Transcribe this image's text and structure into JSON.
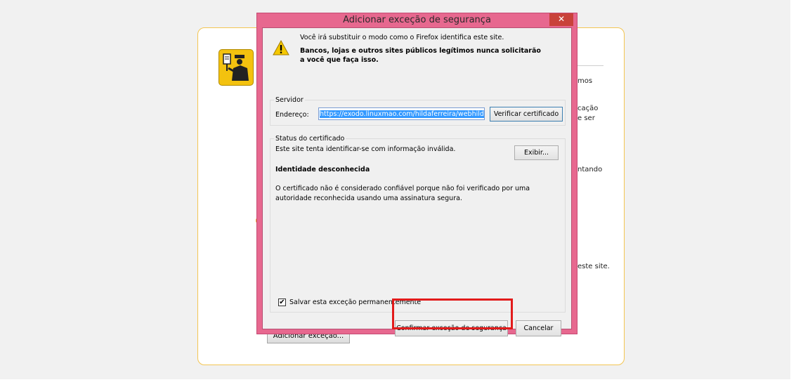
{
  "background": {
    "fragment_1": "mos",
    "fragment_2": "cação",
    "fragment_3": "e ser",
    "fragment_4": "ntando",
    "fragment_5": "este site.",
    "add_exception_button": "Adicionar exceção..."
  },
  "dialog": {
    "title": "Adicionar exceção de segurança",
    "close_glyph": "✕",
    "intro_line": "Você irá substituir o modo como o Firefox identifica este site.",
    "intro_warning": "Bancos, lojas e outros sites públicos legítimos nunca solicitarão a você que faça isso.",
    "server": {
      "legend": "Servidor",
      "address_label": "Endereço:",
      "address_value": "https://exodo.linuxmao.com/hildaferreira/webhild",
      "verify_button": "Verificar certificado"
    },
    "status": {
      "legend": "Status do certificado",
      "summary": "Este site tenta identificar-se com informação inválida.",
      "view_button": "Exibir...",
      "identity_heading": "Identidade desconhecida",
      "description": "O certificado não é considerado confiável porque não foi verificado por uma autoridade reconhecida usando uma assinatura segura."
    },
    "permanent_checkbox": {
      "label": "Salvar esta exceção permanentemente",
      "checked": true,
      "glyph": "✔"
    },
    "confirm_button": "Confirmar exceção de segurança",
    "cancel_button": "Cancelar"
  },
  "colors": {
    "dialog_frame": "#e7688f",
    "close_button": "#c9423a",
    "highlight_box": "#e21b1b",
    "error_panel_border": "#f3c552"
  }
}
